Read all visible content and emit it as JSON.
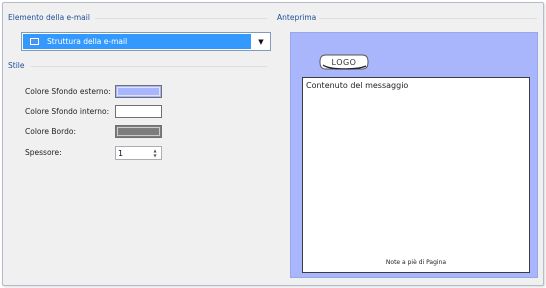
{
  "element_group": {
    "title": "Elemento della e-mail",
    "selected_value": "Struttura della e-mail"
  },
  "style_group": {
    "title": "Stile",
    "outer_bg_label": "Colore Sfondo esterno:",
    "outer_bg_color": "#a9b6fb",
    "inner_bg_label": "Colore Sfondo interno:",
    "inner_bg_color": "#ffffff",
    "border_label": "Colore Bordo:",
    "border_color": "#7d7d7d",
    "thickness_label": "Spessore:",
    "thickness_value": "1"
  },
  "preview_group": {
    "title": "Anteprima",
    "logo_text": "LOGO",
    "message_text": "Contenuto del messaggio",
    "footer_text": "Note a piè di Pagina"
  },
  "icons": {
    "dropdown": "chevron-down-icon",
    "element": "box-icon",
    "stepper_up": "arrow-up-icon",
    "stepper_down": "arrow-down-icon"
  }
}
